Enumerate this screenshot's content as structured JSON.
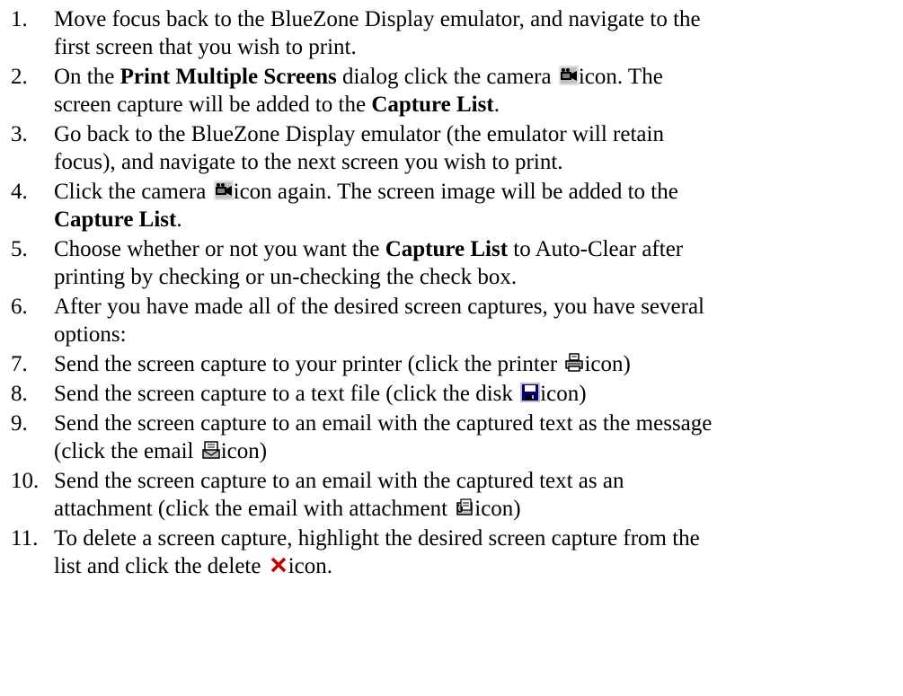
{
  "steps": [
    {
      "num": "1.",
      "line1": "Move focus back to the BlueZone Display emulator, and navigate to the",
      "line2": "first screen that you wish to print."
    },
    {
      "num": "2.",
      "a": "On the ",
      "b_bold": "Print Multiple Screens",
      "c": " dialog click the camera ",
      "icon": "camera-icon",
      "d": "icon.  The",
      "e": "screen capture will be added to the ",
      "f_bold": "Capture List",
      "g": "."
    },
    {
      "num": "3.",
      "line1": "Go back to the BlueZone Display emulator (the emulator will retain",
      "line2": "focus), and navigate to the next screen you wish to print."
    },
    {
      "num": "4.",
      "a": "Click the camera ",
      "icon": "camera-icon",
      "b": "icon again. The screen image will be added to the",
      "c_bold": "Capture List",
      "d": "."
    },
    {
      "num": "5.",
      "a": "Choose whether or not you want the ",
      "b_bold": "Capture List",
      "c": " to Auto-Clear after",
      "d": "printing by checking or un-checking the check box."
    },
    {
      "num": "6.",
      "line1": "After you have made all of the desired screen captures, you have several",
      "line2": "options:"
    },
    {
      "num": "7.",
      "a": "Send the screen capture to your printer (click the printer ",
      "icon": "printer-icon",
      "b": "icon)"
    },
    {
      "num": "8.",
      "a": "Send the screen capture to a text file (click the disk ",
      "icon": "disk-icon",
      "b": "icon)"
    },
    {
      "num": "9.",
      "line1": "Send the screen capture to an email with the captured text as the message",
      "a": "(click the email ",
      "icon": "email-icon",
      "b": "icon)"
    },
    {
      "num": "10.",
      "line1": "Send the screen capture to an email with the captured text as an",
      "a": "attachment (click the email with attachment ",
      "icon": "email-attachment-icon",
      "b": "icon)"
    },
    {
      "num": "11.",
      "line1": "To delete a screen capture, highlight the desired screen capture from the",
      "a": "list and click the delete ",
      "icon": "delete-icon",
      "b": "icon."
    }
  ],
  "colors": {
    "text": "#000000",
    "icon_bg": "#c0c0c0",
    "delete_red": "#c00000",
    "icon_dark": "#000080"
  }
}
